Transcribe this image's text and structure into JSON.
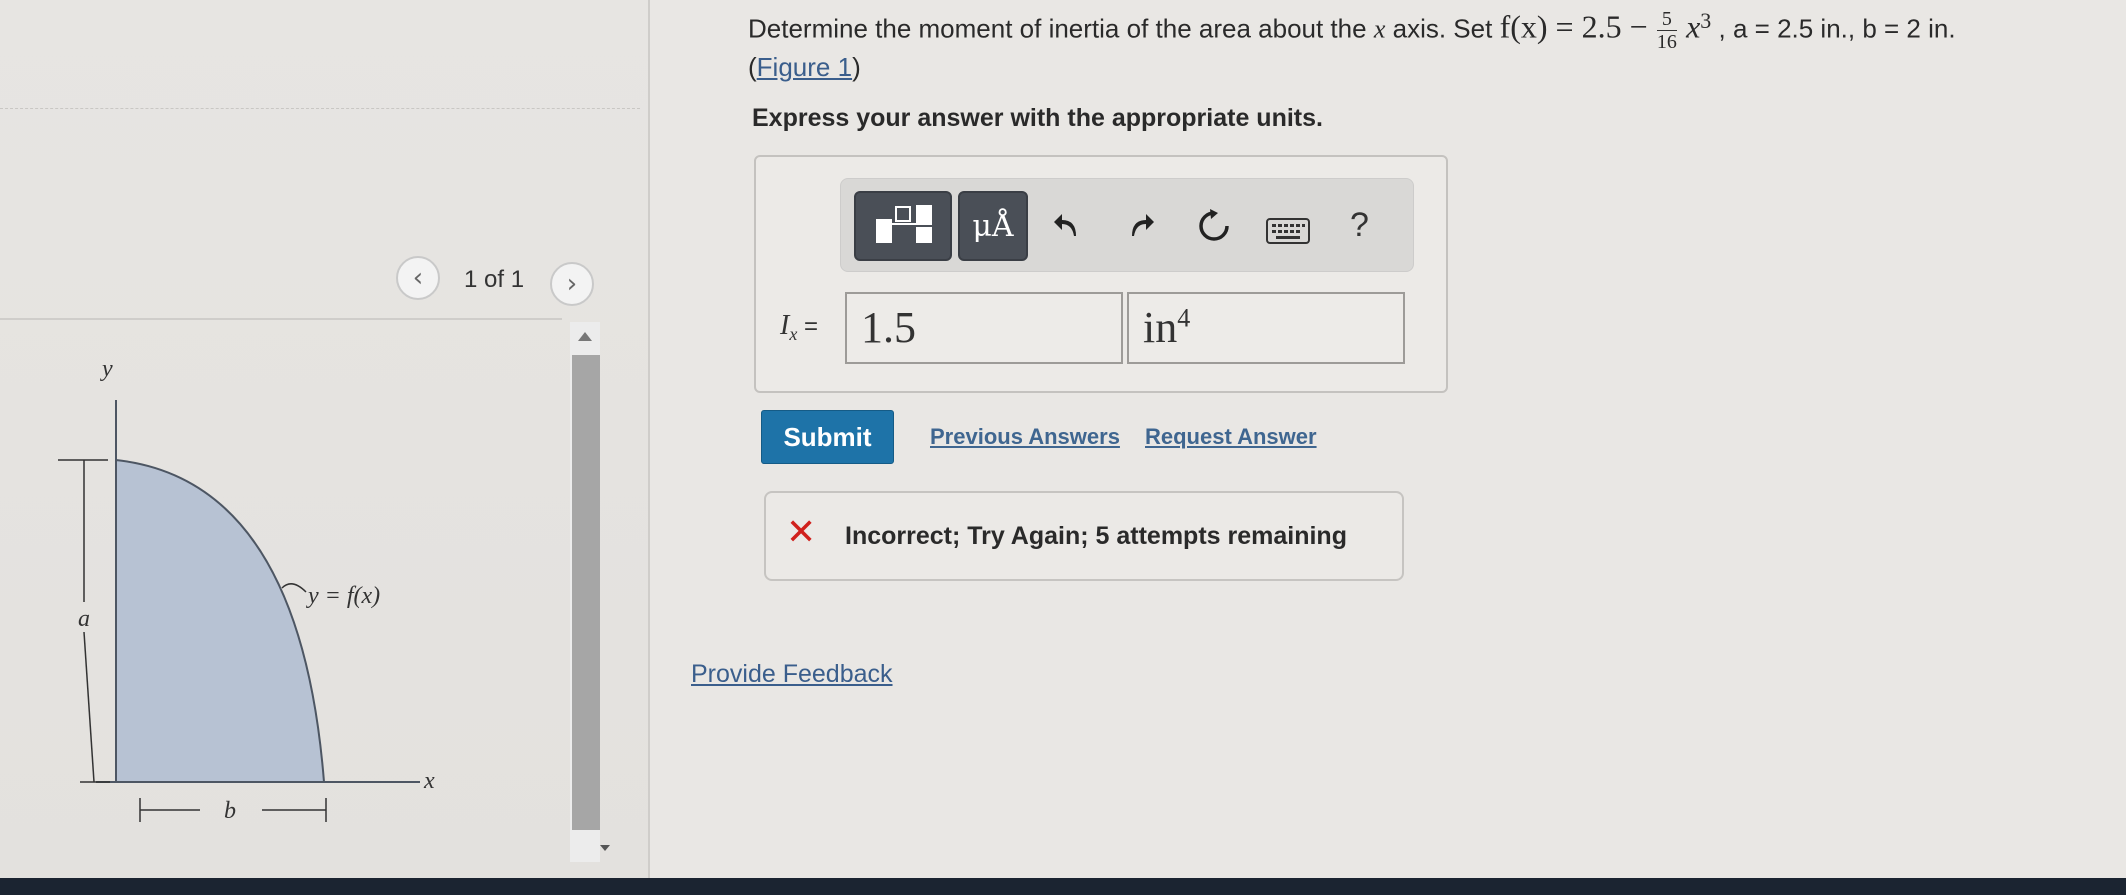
{
  "figure_panel": {
    "pager_text": "1 of 1",
    "labels": {
      "y_axis": "y",
      "x_axis": "x",
      "a": "a",
      "b": "b",
      "curve": "y = f(x)"
    }
  },
  "question": {
    "text_1": "Determine the moment of inertia of the area about the",
    "axis_var": "x",
    "text_2": "axis. Set",
    "f_lhs": "f(x) = 2.5 −",
    "frac_num": "5",
    "frac_den": "16",
    "x_cubed_base": "x",
    "x_cubed_exp": "3",
    "params": ", a = 2.5 in., b = 2 in.",
    "figure_link": "Figure 1",
    "instruction": "Express your answer with the appropriate units."
  },
  "toolbar": {
    "units_label": "μÅ",
    "help_label": "?"
  },
  "answer": {
    "label_var": "I",
    "label_sub": "x",
    "label_eq": "=",
    "value": "1.5",
    "unit": "in",
    "unit_exp": "4"
  },
  "actions": {
    "submit": "Submit",
    "previous_answers": "Previous Answers",
    "request_answer": "Request Answer"
  },
  "feedback": {
    "icon": "✕",
    "message": "Incorrect; Try Again; 5 attempts remaining"
  },
  "provide_feedback": "Provide Feedback",
  "colors": {
    "submit_bg": "#1e73a8",
    "error_red": "#d0201c",
    "link": "#3a5e8c",
    "region_fill": "#b7c2d3"
  }
}
